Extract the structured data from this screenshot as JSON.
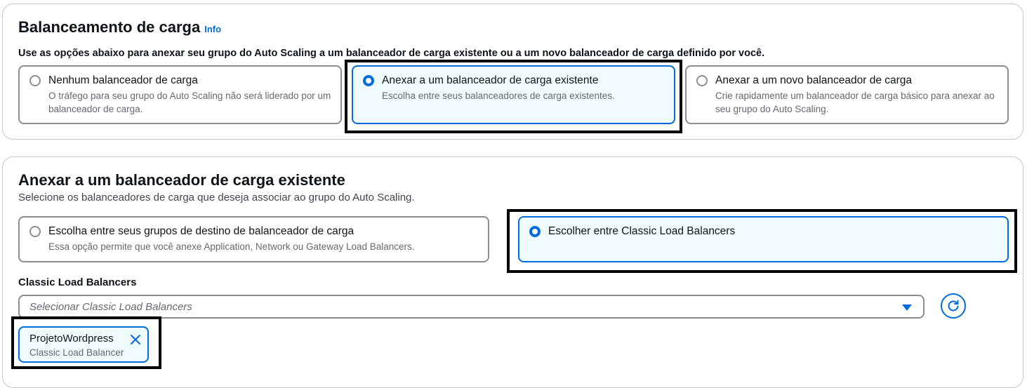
{
  "load_balancing": {
    "title": "Balanceamento de carga",
    "info_label": "Info",
    "description": "Use as opções abaixo para anexar seu grupo do Auto Scaling a um balanceador de carga existente ou a um novo balanceador de carga definido por você.",
    "options": [
      {
        "title": "Nenhum balanceador de carga",
        "description": "O tráfego para seu grupo do Auto Scaling não será liderado por um balanceador de carga.",
        "selected": false
      },
      {
        "title": "Anexar a um balanceador de carga existente",
        "description": "Escolha entre seus balanceadores de carga existentes.",
        "selected": true
      },
      {
        "title": "Anexar a um novo balanceador de carga",
        "description": "Crie rapidamente um balanceador de carga básico para anexar ao seu grupo do Auto Scaling.",
        "selected": false
      }
    ]
  },
  "attach_existing": {
    "title": "Anexar a um balanceador de carga existente",
    "description": "Selecione os balanceadores de carga que deseja associar ao grupo do Auto Scaling.",
    "options": [
      {
        "title": "Escolha entre seus grupos de destino de balanceador de carga",
        "description": "Essa opção permite que você anexe Application, Network ou Gateway Load Balancers.",
        "selected": false
      },
      {
        "title": "Escolher entre Classic Load Balancers",
        "description": "",
        "selected": true
      }
    ],
    "clb_field": {
      "label": "Classic Load Balancers",
      "placeholder": "Selecionar Classic Load Balancers"
    },
    "selected_tokens": [
      {
        "name": "ProjetoWordpress",
        "type": "Classic Load Balancer"
      }
    ]
  },
  "colors": {
    "accent": "#006ce0",
    "selected_bg": "#f0fbff",
    "border": "#8c8c94",
    "highlight": "#000000"
  },
  "icons": {
    "refresh": "refresh-icon",
    "dismiss": "close-icon",
    "dropdown": "caret-down-icon"
  }
}
